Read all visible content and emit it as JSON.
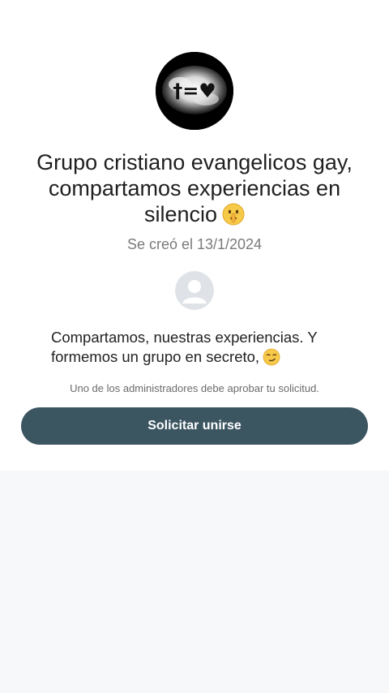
{
  "group": {
    "avatar_text": "†=♥",
    "title": "Grupo cristiano evangelicos gay, compartamos experiencias en silencio",
    "title_emoji": "shushing-face-icon",
    "created": "Se creó el 13/1/2024",
    "description": "Compartamos, nuestras experiencias. Y formemos un grupo en secreto,",
    "description_emoji": "smirking-face-icon"
  },
  "join": {
    "note": "Uno de los administradores debe aprobar tu solicitud.",
    "button_label": "Solicitar unirse"
  },
  "colors": {
    "button_bg": "#3b5561",
    "page_bg": "#f7f8fa",
    "card_bg": "#ffffff"
  }
}
